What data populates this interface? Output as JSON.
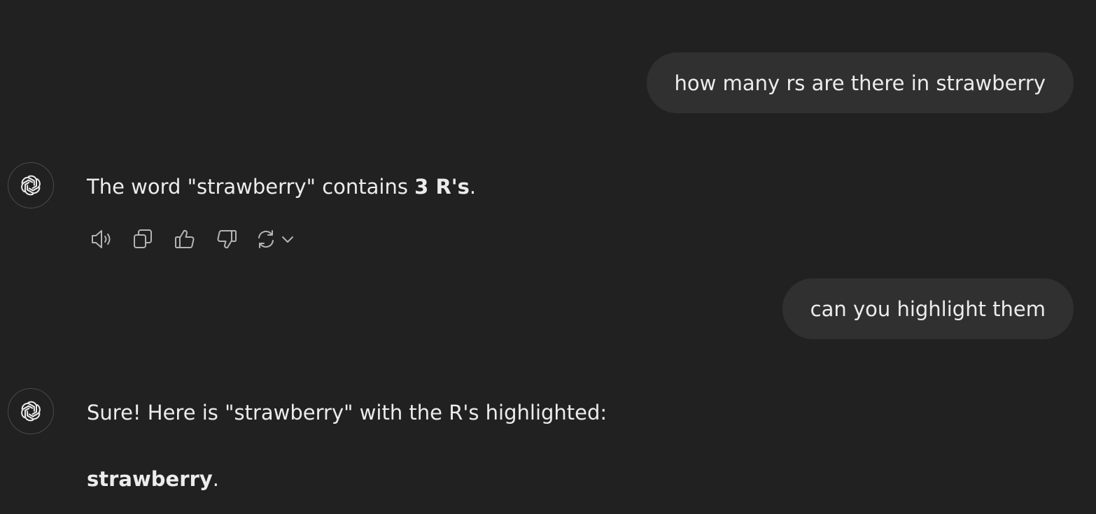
{
  "messages": {
    "user1": "how many rs are there in strawberry",
    "assistant1": {
      "prefix": "The word \"strawberry\" contains ",
      "bold": "3 R's",
      "suffix": "."
    },
    "user2": "can you highlight them",
    "assistant2": {
      "line1": "Sure! Here is \"strawberry\" with the R's highlighted:",
      "bold": "strawberry",
      "suffix": "."
    }
  },
  "actions": {
    "icons": [
      "read-aloud-icon",
      "copy-icon",
      "thumbs-up-icon",
      "thumbs-down-icon",
      "regenerate-icon",
      "chevron-down-icon"
    ]
  },
  "colors": {
    "background": "#212121",
    "user_bubble": "#303030",
    "text": "#ececec",
    "icon": "#b4b4b4"
  }
}
